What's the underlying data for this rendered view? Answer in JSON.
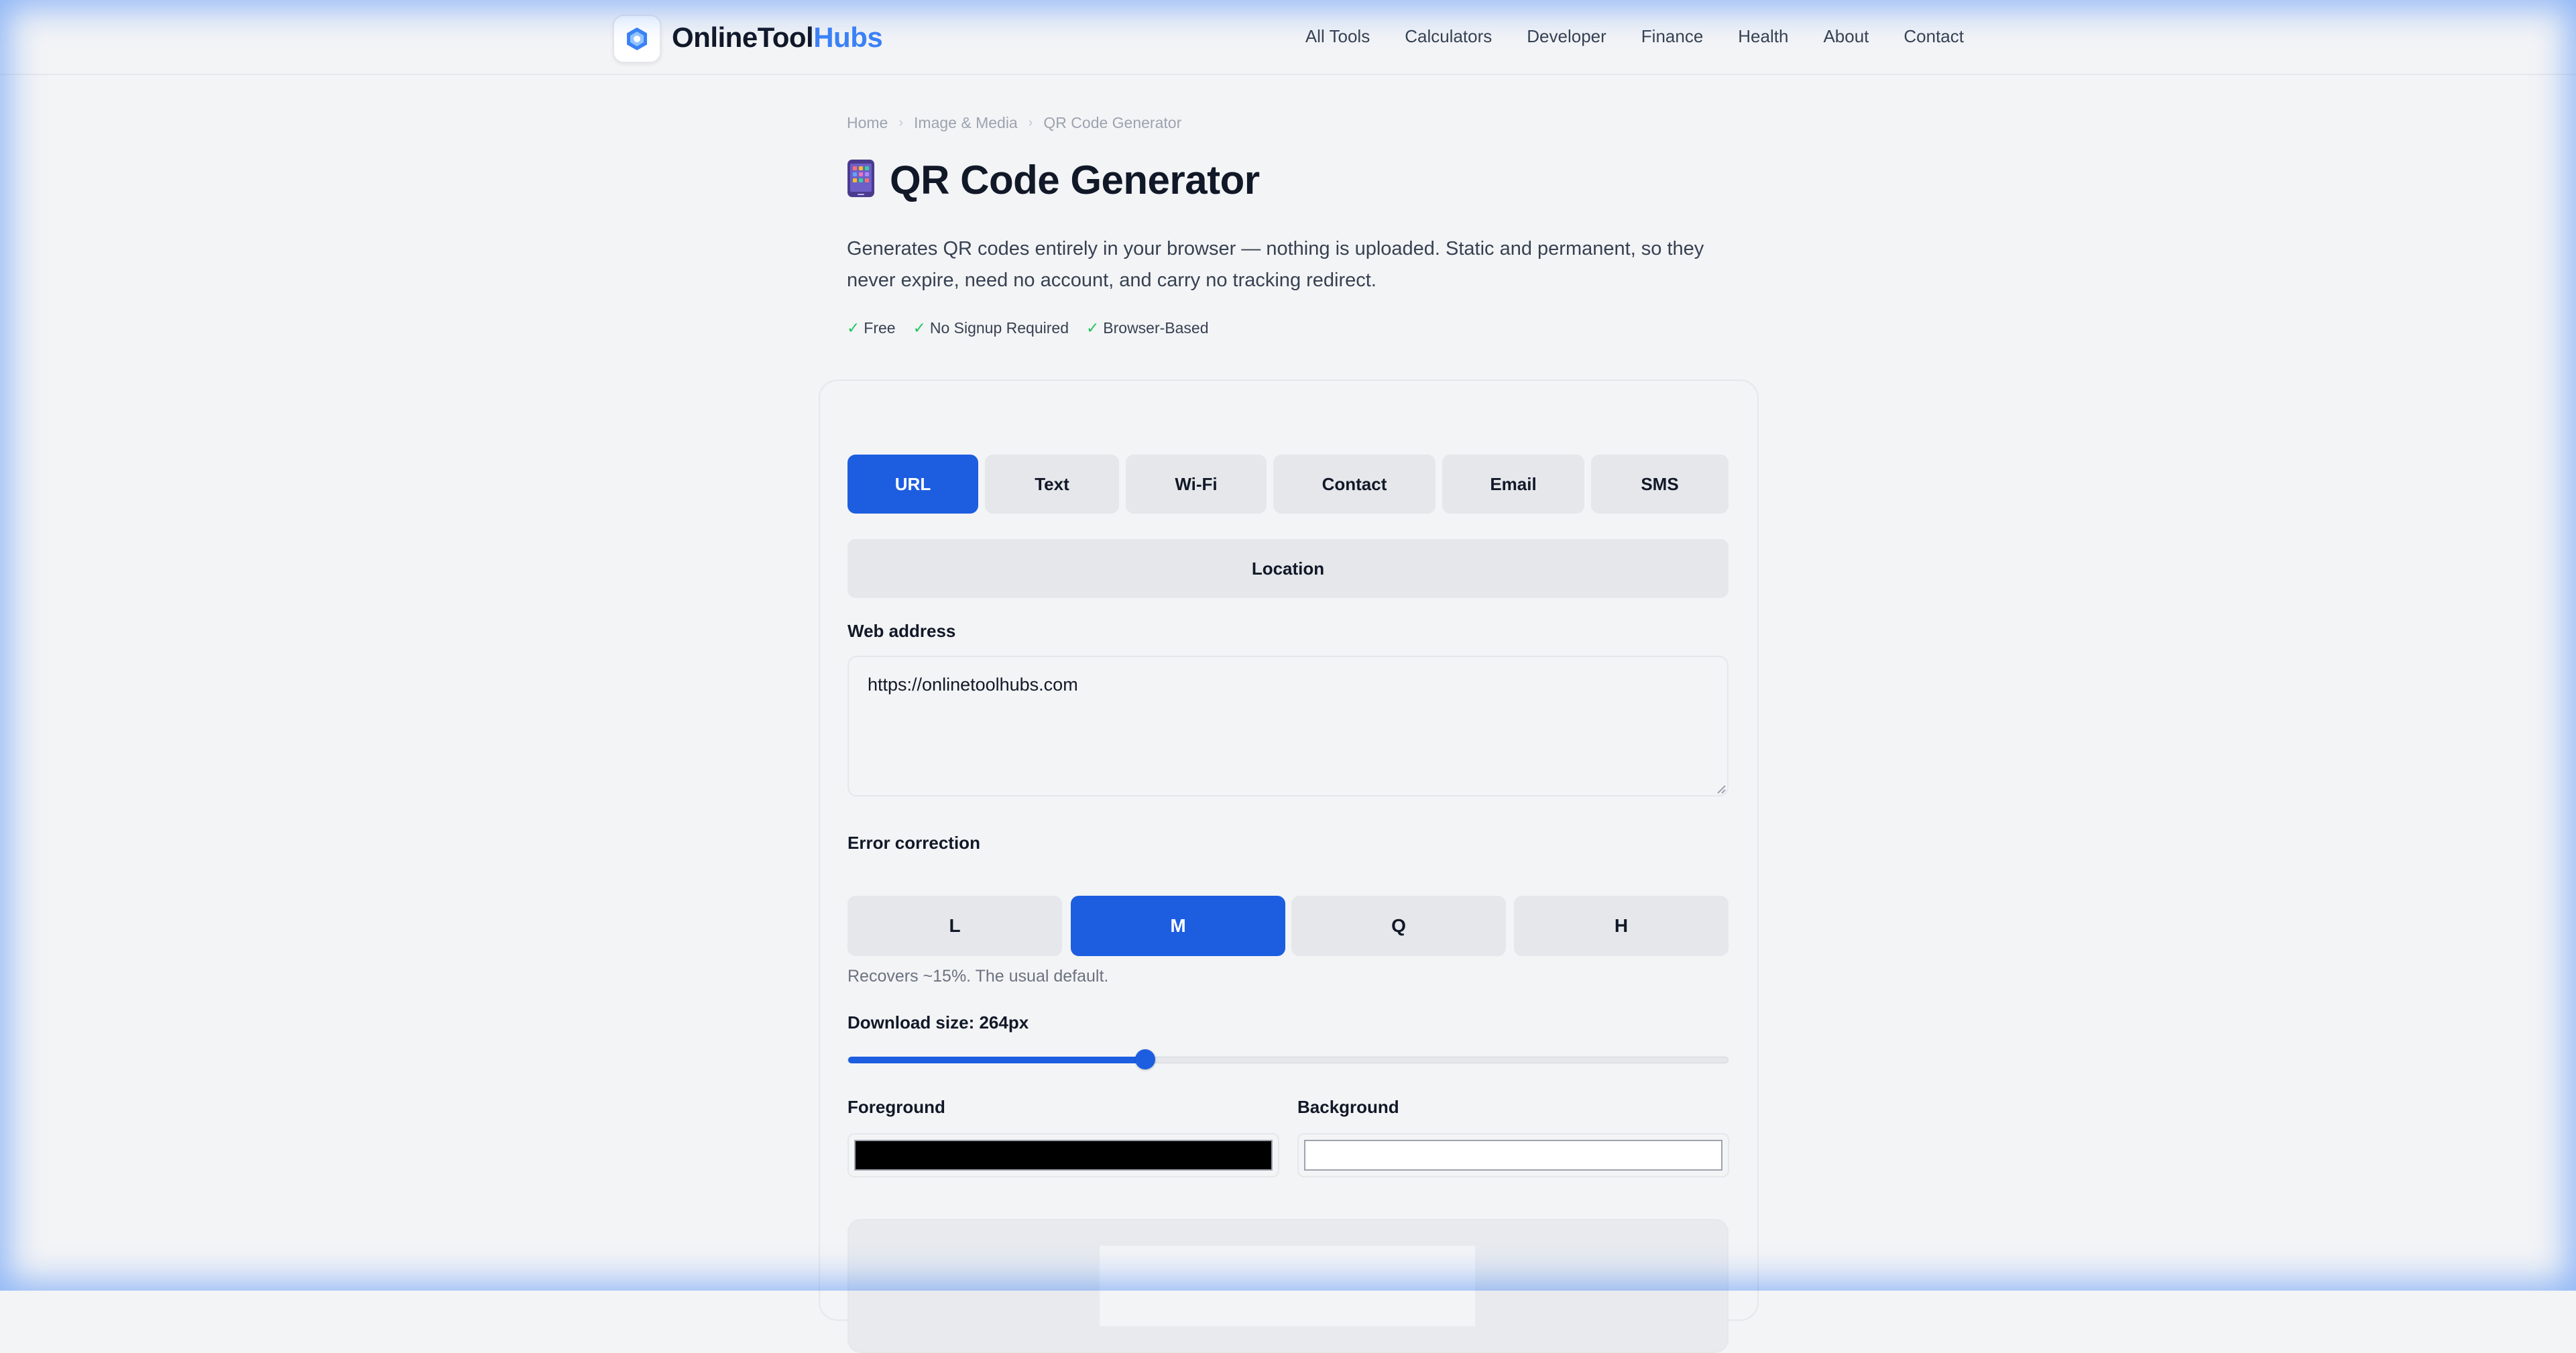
{
  "header": {
    "brand_part1": "OnlineTool",
    "brand_part2": "Hubs",
    "nav": [
      "All Tools",
      "Calculators",
      "Developer",
      "Finance",
      "Health",
      "About",
      "Contact"
    ]
  },
  "breadcrumb": [
    "Home",
    "Image & Media",
    "QR Code Generator"
  ],
  "page": {
    "title": "QR Code Generator",
    "description": "Generates QR codes entirely in your browser — nothing is uploaded. Static and permanent, so they never expire, need no account, and carry no tracking redirect.",
    "badges": [
      "Free",
      "No Signup Required",
      "Browser-Based"
    ],
    "check_glyph": "✓"
  },
  "tabs": [
    "URL",
    "Text",
    "Wi-Fi",
    "Contact",
    "Email",
    "SMS",
    "Location"
  ],
  "active_tab": "URL",
  "web_address": {
    "label": "Web address",
    "value": "https://onlinetoolhubs.com"
  },
  "error_correction": {
    "label": "Error correction",
    "levels": [
      "L",
      "M",
      "Q",
      "H"
    ],
    "selected": "M",
    "hint": "Recovers ~15%. The usual default."
  },
  "download_size": {
    "label": "Download size: 264px",
    "fraction": 0.337
  },
  "colors": {
    "foreground_label": "Foreground",
    "background_label": "Background",
    "foreground": "#000000",
    "background": "#ffffff",
    "accent": "#1d5ee0"
  }
}
